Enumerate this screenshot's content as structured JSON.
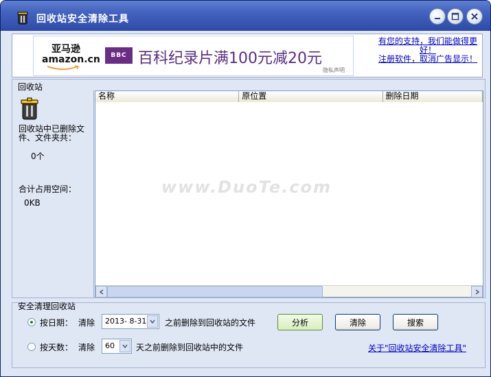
{
  "window": {
    "title": "回收站安全清除工具"
  },
  "ad": {
    "amazon_brand_zh": "亚马逊",
    "amazon_brand_en": "amazon.cn",
    "bbc_label": "BBC",
    "promo": "百科纪录片满100元减20元",
    "privacy": "隐私声明",
    "support_line1": "有您的支持，我们能做得更好！",
    "support_line2": "注册软件，取消广告显示！"
  },
  "recycle": {
    "group_label": "回收站",
    "deleted_label": "回收站中已删除文件、文件夹共：",
    "deleted_count": "0个",
    "space_label": "合计占用空间：",
    "space_value": "0KB",
    "columns": [
      "名称",
      "原位置",
      "删除日期"
    ],
    "rows": []
  },
  "watermark": "www.DuoTe.com",
  "clean": {
    "group_label": "安全清理回收站",
    "by_date_label": "按日期：",
    "clear1": "清除",
    "date_value": "2013- 8-31",
    "by_date_suffix": "之前删除到回收站的文件",
    "by_days_label": "按天数：",
    "clear2": "清除",
    "days_value": "60",
    "by_days_suffix": "天之前删除到回收站中的文件",
    "analyze_btn": "分析",
    "clear_btn": "清除",
    "search_btn": "搜索",
    "about_link": "关于\"回收站安全清除工具\""
  }
}
